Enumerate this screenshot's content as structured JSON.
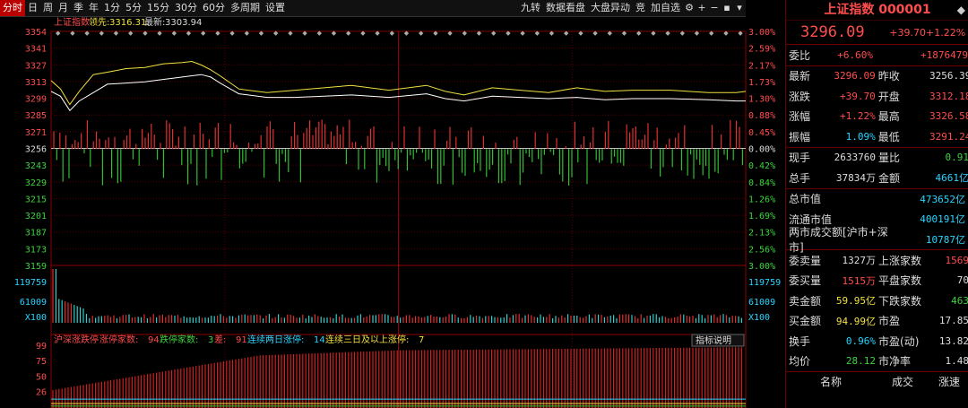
{
  "toolbar": {
    "periods": [
      "分时",
      "日",
      "周",
      "月",
      "季",
      "年",
      "1分",
      "5分",
      "15分",
      "30分",
      "60分",
      "多周期",
      "设置"
    ],
    "active_index": 0,
    "tools": [
      "九转",
      "数据看盘",
      "大盘异动",
      "竞",
      "加自选"
    ]
  },
  "chart_data": {
    "type": "line",
    "legend": {
      "name": "上证指数",
      "lead_label": "领先:",
      "lead_value": "3316.31",
      "latest_label": "最新:",
      "latest_value": "3303.94"
    },
    "price_axis": {
      "max": 3354,
      "min": 3159,
      "ref": 3256,
      "left_ticks": [
        "3354",
        "3341",
        "3327",
        "3313",
        "3299",
        "3285",
        "3271",
        "3256",
        "3243",
        "3229",
        "3215",
        "3201",
        "3187",
        "3173",
        "3159"
      ],
      "right_ticks": [
        "3.00%",
        "2.59%",
        "2.17%",
        "1.73%",
        "1.30%",
        "0.88%",
        "0.45%",
        "0.00%",
        "0.42%",
        "0.84%",
        "1.26%",
        "1.69%",
        "2.13%",
        "2.56%",
        "3.00%"
      ]
    },
    "volume_axis": {
      "labels": [
        "119759",
        "61009",
        "X100"
      ]
    },
    "series": [
      {
        "name": "最新",
        "color": "#ffffff",
        "x": [
          0,
          10,
          20,
          30,
          45,
          60,
          80,
          100,
          120,
          140,
          150,
          160,
          170,
          180,
          200,
          210,
          230,
          260,
          320,
          360,
          400,
          420,
          440,
          470,
          500,
          530,
          560,
          590,
          620,
          660,
          700,
          730,
          740
        ],
        "y": [
          3304,
          3300,
          3288,
          3296,
          3303,
          3310,
          3311,
          3312,
          3314,
          3316,
          3317,
          3318,
          3316,
          3311,
          3302,
          3301,
          3299,
          3299,
          3301,
          3299,
          3302,
          3298,
          3296,
          3300,
          3299,
          3298,
          3299,
          3297,
          3298,
          3298,
          3297,
          3296,
          3296
        ]
      },
      {
        "name": "领先",
        "color": "#f0e040",
        "x": [
          0,
          10,
          20,
          30,
          45,
          60,
          80,
          100,
          120,
          140,
          150,
          160,
          170,
          180,
          200,
          210,
          230,
          260,
          320,
          360,
          400,
          420,
          440,
          470,
          500,
          530,
          560,
          590,
          620,
          660,
          700,
          730,
          740
        ],
        "y": [
          3313,
          3306,
          3293,
          3304,
          3318,
          3320,
          3323,
          3324,
          3327,
          3328,
          3329,
          3326,
          3322,
          3317,
          3306,
          3305,
          3303,
          3305,
          3309,
          3305,
          3309,
          3304,
          3301,
          3307,
          3305,
          3303,
          3307,
          3304,
          3305,
          3305,
          3303,
          3303,
          3304
        ]
      }
    ],
    "time_ticks": 5,
    "indicator": {
      "title": "沪深涨跌停",
      "limit_up_label": "涨停家数:",
      "limit_up": "94",
      "limit_down_label": "跌停家数:",
      "limit_down": "3",
      "diff_label": "差:",
      "diff": "91",
      "consec2_label": "连续两日涨停:",
      "consec2": "14",
      "consec3_label": "连续三日及以上涨停:",
      "consec3": "7",
      "button": "指标说明",
      "ticks": [
        "99",
        "75",
        "50",
        "26"
      ],
      "ylim": [
        0,
        99
      ]
    }
  },
  "quote": {
    "title": "上证指数 000001",
    "price": "3296.09",
    "change": "+39.70",
    "change_pct": "+1.22%",
    "webi_label": "委比",
    "webi": "+6.60%",
    "weicha": "+1876479",
    "rows1": [
      {
        "l1": "最新",
        "v1": "3296.09",
        "c1": "red",
        "l2": "昨收",
        "v2": "3256.39",
        "c2": "white"
      },
      {
        "l1": "涨跌",
        "v1": "+39.70",
        "c1": "red",
        "l2": "开盘",
        "v2": "3312.18",
        "c2": "red"
      },
      {
        "l1": "涨幅",
        "v1": "+1.22%",
        "c1": "red",
        "l2": "最高",
        "v2": "3326.58",
        "c2": "red"
      },
      {
        "l1": "振幅",
        "v1": "1.09%",
        "c1": "cyan",
        "l2": "最低",
        "v2": "3291.24",
        "c2": "red"
      }
    ],
    "rows2": [
      {
        "l1": "现手",
        "v1": "2633760",
        "c1": "white",
        "l2": "量比",
        "v2": "0.91",
        "c2": "green"
      },
      {
        "l1": "总手",
        "v1": "37834万",
        "c1": "white",
        "l2": "金额",
        "v2": "4661亿",
        "c2": "cyan"
      }
    ],
    "rows3": [
      {
        "l": "总市值",
        "v": "473652亿"
      },
      {
        "l": "流通市值",
        "v": "400191亿"
      },
      {
        "l": "两市成交额[沪市+深市]",
        "v": "10787亿"
      }
    ],
    "rows4": [
      {
        "l1": "委卖量",
        "v1": "1327万",
        "c1": "white",
        "l2": "上涨家数",
        "v2": "1569",
        "c2": "red"
      },
      {
        "l1": "委买量",
        "v1": "1515万",
        "c1": "red",
        "l2": "平盘家数",
        "v2": "70",
        "c2": "white"
      },
      {
        "l1": "卖金额",
        "v1": "59.95亿",
        "c1": "yellow",
        "l2": "下跌家数",
        "v2": "463",
        "c2": "green"
      },
      {
        "l1": "买金额",
        "v1": "94.99亿",
        "c1": "yellow",
        "l2": "市盈",
        "v2": "17.85",
        "c2": "white"
      },
      {
        "l1": "换手",
        "v1": "0.96%",
        "c1": "cyan",
        "l2": "市盈(动)",
        "v2": "13.82",
        "c2": "white"
      },
      {
        "l1": "均价",
        "v1": "28.12",
        "c1": "green",
        "l2": "市净率",
        "v2": "1.48",
        "c2": "white"
      }
    ],
    "list_headers": [
      "名称",
      "成交",
      "涨速"
    ]
  }
}
